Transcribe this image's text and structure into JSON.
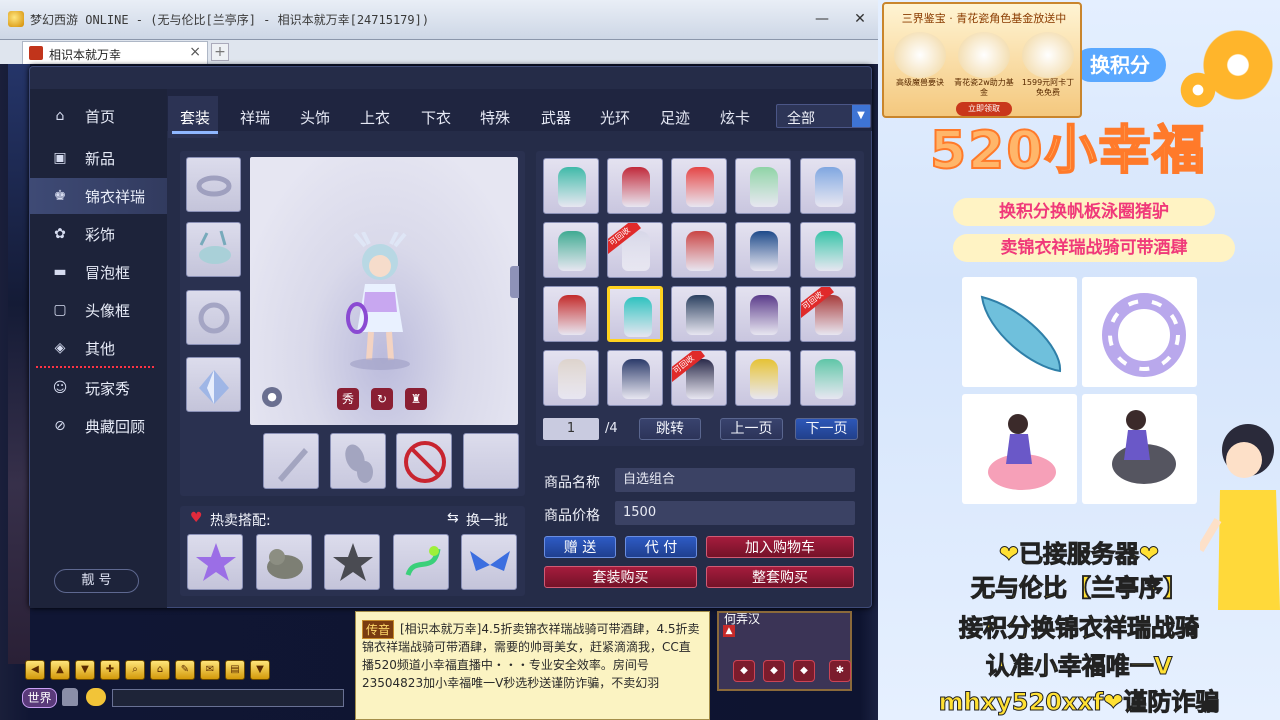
{
  "window": {
    "title": "梦幻西游 ONLINE - (无与伦比[兰亭序] - 相识本就万幸[24715179])",
    "tab_label": "相识本就万幸",
    "min_label": "—",
    "close_label": "✕"
  },
  "sidebar": {
    "items": [
      {
        "label": "首页",
        "icon": "home-icon",
        "glyph": "⌂"
      },
      {
        "label": "新品",
        "icon": "gift-icon",
        "glyph": "▣"
      },
      {
        "label": "锦衣祥瑞",
        "icon": "shirt-icon",
        "glyph": "♚"
      },
      {
        "label": "彩饰",
        "icon": "ornament-icon",
        "glyph": "✿"
      },
      {
        "label": "冒泡框",
        "icon": "bubble-icon",
        "glyph": "▬"
      },
      {
        "label": "头像框",
        "icon": "portrait-icon",
        "glyph": "▢"
      },
      {
        "label": "其他",
        "icon": "layers-icon",
        "glyph": "◈"
      },
      {
        "label": "玩家秀",
        "icon": "player-icon",
        "glyph": "☺"
      },
      {
        "label": "典藏回顾",
        "icon": "forbidden-icon",
        "glyph": "⊘"
      }
    ],
    "active_index": 2,
    "bottom_button": "靓 号"
  },
  "categories": {
    "items": [
      "套装",
      "祥瑞",
      "头饰",
      "上衣",
      "下衣",
      "特殊",
      "武器",
      "光环",
      "足迹",
      "炫卡"
    ],
    "active": "套装",
    "select_value": "全部",
    "select_arrow": "▼"
  },
  "preview": {
    "buttons": [
      "秀",
      "↻",
      "♜"
    ]
  },
  "hot": {
    "title": "热卖搭配:",
    "refresh": "换一批"
  },
  "grid": {
    "cells": [
      {
        "color": "#3fb9a8",
        "ribbon": ""
      },
      {
        "color": "#c0293a",
        "ribbon": ""
      },
      {
        "color": "#e44545",
        "ribbon": ""
      },
      {
        "color": "#8fd3a6",
        "ribbon": ""
      },
      {
        "color": "#7fa6e0",
        "ribbon": ""
      },
      {
        "color": "#3faa92",
        "ribbon": ""
      },
      {
        "color": "#d7d7e8",
        "ribbon": "可回收"
      },
      {
        "color": "#c94545",
        "ribbon": ""
      },
      {
        "color": "#1e4a8a",
        "ribbon": ""
      },
      {
        "color": "#36c3a7",
        "ribbon": ""
      },
      {
        "color": "#c22a2a",
        "ribbon": ""
      },
      {
        "color": "#2fc2bf",
        "ribbon": ""
      },
      {
        "color": "#2a3f5f",
        "ribbon": ""
      },
      {
        "color": "#5a3a8a",
        "ribbon": ""
      },
      {
        "color": "#a63a3a",
        "ribbon": "可回收"
      },
      {
        "color": "#ddd3cc",
        "ribbon": ""
      },
      {
        "color": "#2b3a6a",
        "ribbon": ""
      },
      {
        "color": "#2a2a4a",
        "ribbon": "可回收"
      },
      {
        "color": "#e5c235",
        "ribbon": ""
      },
      {
        "color": "#5fc5a7",
        "ribbon": ""
      }
    ],
    "selected_index": 11
  },
  "pager": {
    "page": "1",
    "total": "/4",
    "jump": "跳转",
    "prev": "上一页",
    "next": "下一页"
  },
  "info": {
    "name_label": "商品名称",
    "name_value": "自选组合",
    "price_label": "商品价格",
    "price_value": "1500"
  },
  "actions": {
    "gift": "赠 送",
    "proxy": "代 付",
    "add_cart": "加入购物车",
    "set_buy": "套装购买",
    "whole_buy": "整套购买"
  },
  "chat": {
    "tag": "传音",
    "message": "[相识本就万幸]4.5折卖锦衣祥瑞战骑可带酒肆，4.5折卖锦衣祥瑞战骑可带酒肆，需要的帅哥美女，赶紧滴滴我，CC直播520频道小幸福直播中・・・专业安全效率。房间号23504823加小幸福唯一V秒选秒送谨防诈骗，不卖幻羽"
  },
  "minimap": {
    "name": "何弄汉"
  },
  "hud": {
    "world": "世界"
  },
  "ad": {
    "banner_title": "三界鉴宝 · 青花瓷角色基金放送中",
    "gift_labels": [
      "高级魔兽要诀",
      "青花瓷2w助力基金",
      "1599元阿卡丁免免费"
    ],
    "claim": "立即领取",
    "jifen": "换积分",
    "title": "520小幸福",
    "pill1": "换积分换帆板泳圈猪驴",
    "pill2": "卖锦衣祥瑞战骑可带酒肆",
    "line1": "❤已接服务器❤",
    "line2": "无与伦比【兰亭序】",
    "line3": "接积分换锦衣祥瑞战骑",
    "line4": "认准小幸福唯一V",
    "line5": "mhxy520xxf❤谨防诈骗"
  }
}
